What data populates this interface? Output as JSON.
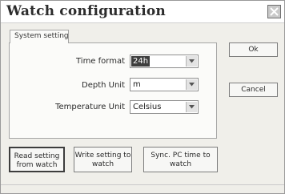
{
  "window": {
    "title": "Watch configuration"
  },
  "tabs": [
    {
      "label": "System setting"
    }
  ],
  "fields": {
    "time_format": {
      "label": "Time format",
      "value": "24h"
    },
    "depth_unit": {
      "label": "Depth Unit",
      "value": "m"
    },
    "temperature_unit": {
      "label": "Temperature Unit",
      "value": "Celsius"
    }
  },
  "buttons": {
    "ok": "Ok",
    "cancel": "Cancel",
    "read_line1": "Read setting",
    "read_line2": "from watch",
    "write_line1": "Write setting to",
    "write_line2": "watch",
    "sync_line1": "Sync. PC time to",
    "sync_line2": "watch"
  },
  "icons": {
    "close": "close-icon",
    "dropdown": "chevron-down-icon"
  }
}
